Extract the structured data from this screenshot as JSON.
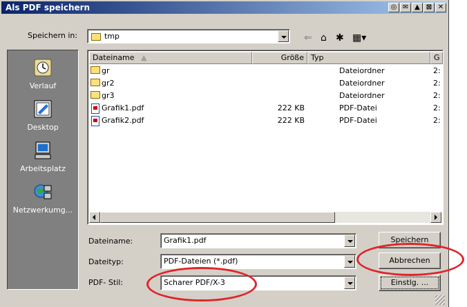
{
  "window": {
    "title": "Als PDF speichern",
    "title_buttons": [
      "◎",
      "✉",
      "▲",
      "⊠",
      "✕"
    ]
  },
  "save_in": {
    "label": "Speichern in:",
    "value": "tmp",
    "toolbar_icons": [
      "back-icon",
      "up-folder-icon",
      "new-folder-icon",
      "view-menu-icon"
    ]
  },
  "places": [
    {
      "label": "Verlauf",
      "icon": "history-icon"
    },
    {
      "label": "Desktop",
      "icon": "desktop-icon"
    },
    {
      "label": "Arbeitsplatz",
      "icon": "my-computer-icon"
    },
    {
      "label": "Netzwerkumg...",
      "icon": "network-icon"
    }
  ],
  "file_list": {
    "columns": [
      "Dateiname",
      "Größe",
      "Typ",
      "G"
    ],
    "rows": [
      {
        "name": "gr",
        "size": "",
        "type": "Dateiordner",
        "date": "2:",
        "icon": "folder-icon"
      },
      {
        "name": "gr2",
        "size": "",
        "type": "Dateiordner",
        "date": "2:",
        "icon": "folder-icon"
      },
      {
        "name": "gr3",
        "size": "",
        "type": "Dateiordner",
        "date": "2:",
        "icon": "folder-icon"
      },
      {
        "name": "Grafik1.pdf",
        "size": "222 KB",
        "type": "PDF-Datei",
        "date": "2:",
        "icon": "pdf-file-icon"
      },
      {
        "name": "Grafik2.pdf",
        "size": "222 KB",
        "type": "PDF-Datei",
        "date": "2:",
        "icon": "pdf-file-icon"
      }
    ]
  },
  "filename": {
    "label": "Dateiname:",
    "value": "Grafik1.pdf"
  },
  "filetype": {
    "label": "Dateityp:",
    "value": "PDF-Dateien (*.pdf)"
  },
  "pdf_style": {
    "label": "PDF- Stil:",
    "value": "Scharer PDF/X-3"
  },
  "buttons": {
    "save": "Speichern",
    "cancel": "Abbrechen",
    "settings": "Einstlg. ..."
  },
  "colors": {
    "annotation": "#e0242a",
    "titlebar_start": "#0a246a",
    "titlebar_end": "#a6caf0"
  }
}
